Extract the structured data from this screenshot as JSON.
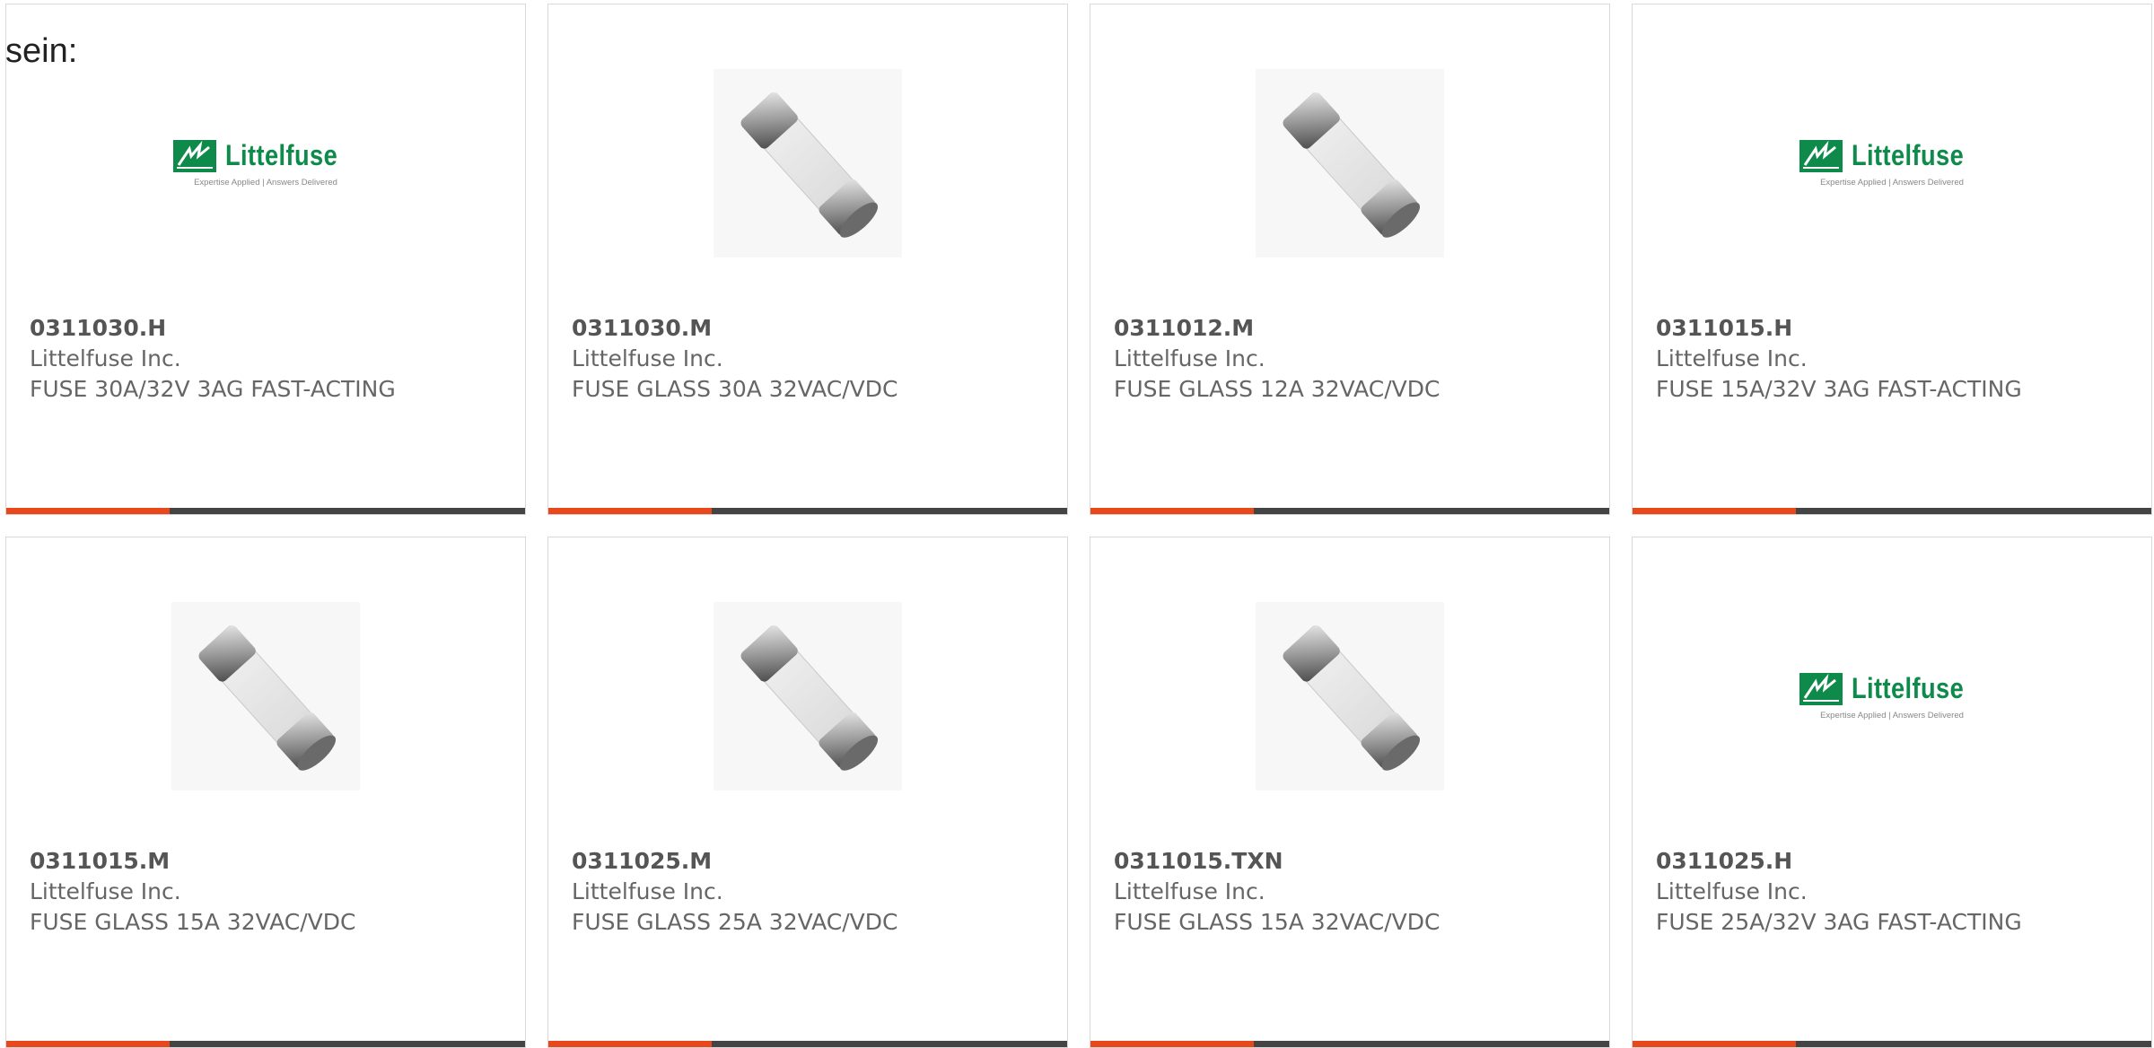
{
  "intro_text": "sein:",
  "colors": {
    "accent": "#e8481c",
    "bar": "#444444",
    "brand_green": "#0e8a4b"
  },
  "logo": {
    "name": "Littelfuse",
    "tagline": "Expertise Applied  |  Answers Delivered"
  },
  "products": [
    {
      "part": "0311030.H",
      "manufacturer": "Littelfuse Inc.",
      "description": "FUSE 30A/32V 3AG FAST-ACTING",
      "image": "littelfuse-logo"
    },
    {
      "part": "0311030.M",
      "manufacturer": "Littelfuse Inc.",
      "description": "FUSE GLASS 30A 32VAC/VDC",
      "image": "glass-fuse-icon"
    },
    {
      "part": "0311012.M",
      "manufacturer": "Littelfuse Inc.",
      "description": "FUSE GLASS 12A 32VAC/VDC",
      "image": "glass-fuse-icon"
    },
    {
      "part": "0311015.H",
      "manufacturer": "Littelfuse Inc.",
      "description": "FUSE 15A/32V 3AG FAST-ACTING",
      "image": "littelfuse-logo"
    },
    {
      "part": "0311015.M",
      "manufacturer": "Littelfuse Inc.",
      "description": "FUSE GLASS 15A 32VAC/VDC",
      "image": "glass-fuse-icon"
    },
    {
      "part": "0311025.M",
      "manufacturer": "Littelfuse Inc.",
      "description": "FUSE GLASS 25A 32VAC/VDC",
      "image": "glass-fuse-icon"
    },
    {
      "part": "0311015.TXN",
      "manufacturer": "Littelfuse Inc.",
      "description": "FUSE GLASS 15A 32VAC/VDC",
      "image": "glass-fuse-icon"
    },
    {
      "part": "0311025.H",
      "manufacturer": "Littelfuse Inc.",
      "description": "FUSE 25A/32V 3AG FAST-ACTING",
      "image": "littelfuse-logo"
    }
  ]
}
